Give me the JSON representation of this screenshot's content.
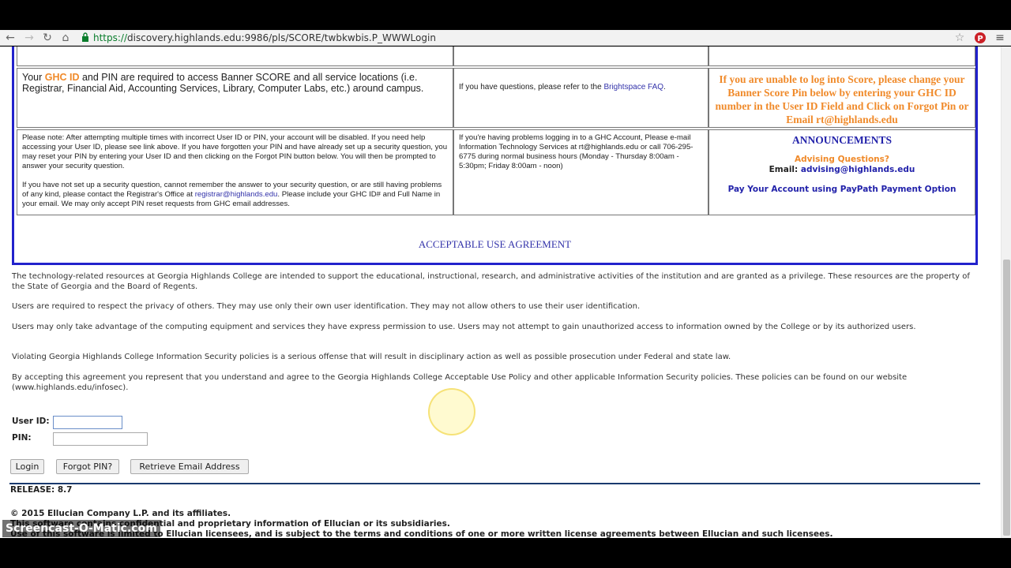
{
  "browser": {
    "url_scheme": "https://",
    "url_host": "discovery.highlands.edu",
    "url_path": ":9986/pls/SCORE/twbkwbis.P_WWWLogin"
  },
  "info": {
    "cell1_prefix": "Your ",
    "cell1_ghc": "GHC ID",
    "cell1_rest": " and PIN are required to access Banner SCORE and all service locations (i.e. Registrar, Financial Aid, Accounting Services, Library, Computer Labs, etc.) around campus.",
    "cell2_prefix": "If you have questions, please refer to the ",
    "cell2_link": "Brightspace FAQ",
    "cell2_suffix": ".",
    "cell3": "If you are unable to log into Score, please change your Banner Score Pin below by entering your GHC ID number in the User ID Field and Click on Forgot Pin or Email rt@highlands.edu",
    "cell4_p1": "Please note: After attempting multiple times with incorrect User ID or PIN, your account will be disabled. If you need help accessing your User ID, please see link above. If you have forgotten your PIN and have already set up a security question, you may reset your PIN by entering your User ID and then clicking on the Forgot PIN button below. You will then be prompted to answer your security question.",
    "cell4_p2_prefix": "If you have not set up a security question, cannot remember the answer to your security question, or are still having problems of any kind, please contact the Registrar's Office at ",
    "cell4_p2_link": "registrar@highlands.edu",
    "cell4_p2_suffix": ". Please include your GHC ID# and Full Name in your email. We may only accept PIN reset requests from GHC email addresses.",
    "cell5": "If you're having problems logging in to a GHC Account, Please e-mail Information Technology Services at rt@highlands.edu or call 706-295-6775 during normal business hours (Monday - Thursday 8:00am - 5:30pm; Friday 8:00am - noon)",
    "announcements_title": "ANNOUNCEMENTS",
    "advising_q": "Advising Questions?",
    "email_label": "Email: ",
    "email_value": "advising@highlands.edu",
    "paypath": "Pay Your Account using PayPath Payment Option"
  },
  "aua": {
    "title": "ACCEPTABLE USE AGREEMENT",
    "p1": "The technology-related resources at Georgia Highlands College are intended to support the educational, instructional, research, and administrative activities of the institution and are granted as a privilege. These resources are the property of the State of Georgia and the Board of Regents.",
    "p2": "Users are required to respect the privacy of others. They may use only their own user identification. They may not allow others to use their user identification.",
    "p3": "Users may only take advantage of the computing equipment and services they have express permission to use. Users may not attempt to gain unauthorized access to information owned by the College or by its authorized users.",
    "p4": "Violating Georgia Highlands College Information Security policies is a serious offense that will result in disciplinary action as well as possible prosecution under Federal and state law.",
    "p5": "By accepting this agreement you represent that you understand and agree to the Georgia Highlands College Acceptable Use Policy and other applicable Information Security policies. These policies can be found on our website (www.highlands.edu/infosec)."
  },
  "login": {
    "userid_label": "User ID:",
    "pin_label": "PIN:",
    "userid_value": "",
    "pin_value": "",
    "login_btn": "Login",
    "forgot_btn": "Forgot PIN?",
    "retrieve_btn": "Retrieve Email Address"
  },
  "footer": {
    "release": "RELEASE: 8.7",
    "copyright": "© 2015 Ellucian Company L.P. and its affiliates.",
    "line2": "This software contains confidential and proprietary information of Ellucian or its subsidiaries.",
    "line3": "Use of this software is limited to Ellucian licensees, and is subject to the terms and conditions of one or more written license agreements between Ellucian and such licensees."
  },
  "overlay": {
    "watermark": "Screencast-O-Matic.com"
  }
}
